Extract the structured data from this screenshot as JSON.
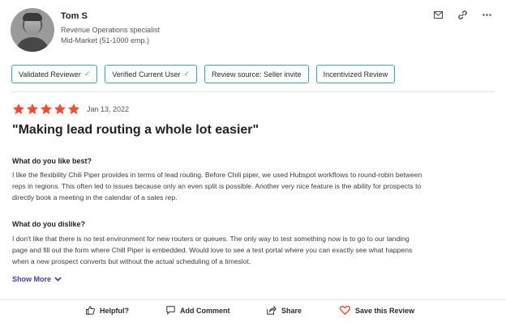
{
  "reviewer": {
    "name": "Tom S",
    "role": "Revenue Operations specialist",
    "segment": "Mid-Market (51-1000 emp.)"
  },
  "top_icons": [
    "mail-icon",
    "link-icon",
    "more-icon"
  ],
  "badges": [
    {
      "label": "Validated Reviewer",
      "checked": true
    },
    {
      "label": "Verified Current User",
      "checked": true
    },
    {
      "label": "Review source: Seller invite",
      "checked": false
    },
    {
      "label": "Incentivized Review",
      "checked": false
    }
  ],
  "rating": {
    "stars": 5,
    "max": 5,
    "color": "#ff492c"
  },
  "date": "Jan 13, 2022",
  "title": "\"Making lead routing a whole lot easier\"",
  "like": {
    "question": "What do you like best?",
    "lines": [
      "I like the flexibility Chili Piper provides in terms of lead routing. Before Chili piper, we used Hubspot workflows to round-robin between",
      "reps in regions. This often led to issues because only an even split is possible. Another very nice feature is the ability for prospects to",
      "directly book a meeting in the calendar of a sales rep."
    ]
  },
  "dislike": {
    "question": "What do you dislike?",
    "lines": [
      "I don't like that there is no test environment for new routers or queues. The only way to test something now is to go to our landing",
      "page and fill out the form where Chill Piper is embedded. Would love to see a test portal where you can exactly see what happens",
      "when a new prospect converts but without the actual scheduling of a timeslot."
    ]
  },
  "show_more": "Show More",
  "footer": {
    "helpful": "Helpful?",
    "add_comment": "Add Comment",
    "share": "Share",
    "save": "Save this Review"
  },
  "colors": {
    "accent_teal": "#2fb3a4",
    "star_red": "#ff492c",
    "link_purple": "#4a3aa8",
    "save_heart": "#ff492c"
  }
}
